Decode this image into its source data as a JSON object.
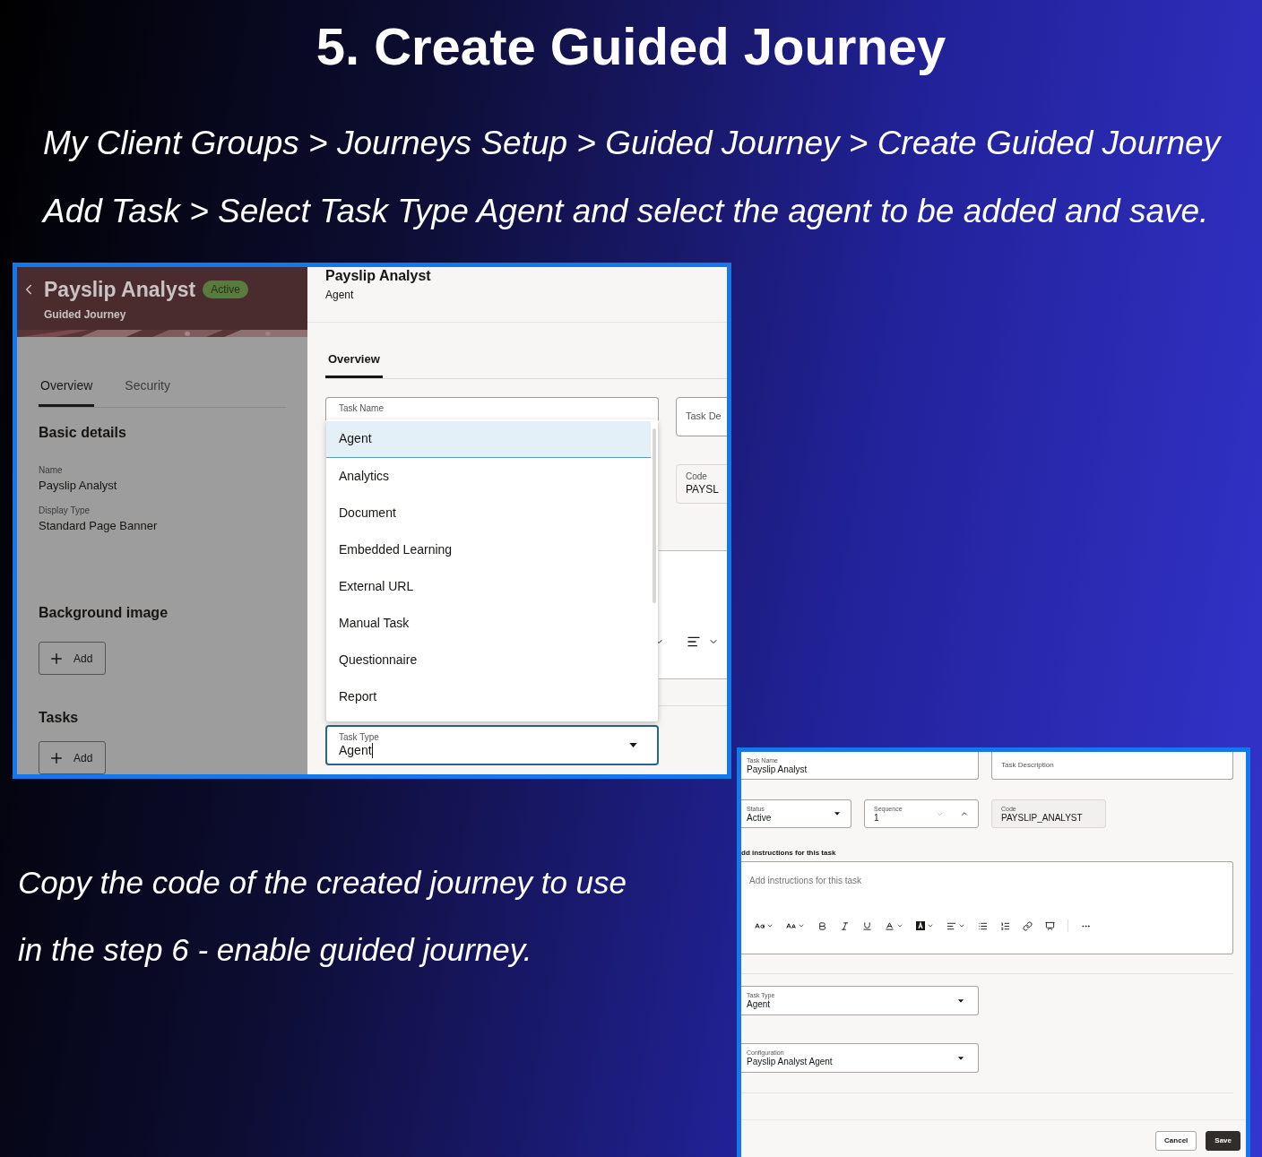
{
  "heading": "5. Create Guided Journey",
  "instructions": [
    "My Client Groups > Journeys Setup > Guided Journey > Create Guided Journey",
    "Add Task  > Select Task Type Agent and select the agent to be added and save."
  ],
  "screenshot_1": {
    "banner": {
      "title": "Payslip Analyst",
      "status": "Active",
      "subtitle": "Guided Journey"
    },
    "tabs": [
      {
        "label": "Overview",
        "selected": true
      },
      {
        "label": "Security",
        "selected": false
      }
    ],
    "basic_details": {
      "heading": "Basic details",
      "fields": [
        {
          "label": "Name",
          "value": "Payslip Analyst"
        },
        {
          "label": "Display Type",
          "value": "Standard Page Banner"
        }
      ]
    },
    "background_image": {
      "heading": "Background image",
      "button": "Add"
    },
    "tasks": {
      "heading": "Tasks",
      "button": "Add"
    },
    "task_panel": {
      "title": "Payslip Analyst",
      "subtitle": "Agent",
      "tabs": [
        {
          "label": "Overview",
          "selected": true
        }
      ],
      "task_name": {
        "label": "Task Name"
      },
      "task_description": {
        "label": "Task De"
      },
      "code": {
        "label": "Code",
        "value": "PAYSL"
      },
      "task_type_options": [
        {
          "label": "Agent",
          "selected": true
        },
        {
          "label": "Analytics",
          "selected": false
        },
        {
          "label": "Document",
          "selected": false
        },
        {
          "label": "Embedded Learning",
          "selected": false
        },
        {
          "label": "External URL",
          "selected": false
        },
        {
          "label": "Manual Task",
          "selected": false
        },
        {
          "label": "Questionnaire",
          "selected": false
        },
        {
          "label": "Report",
          "selected": false
        }
      ],
      "task_type": {
        "label": "Task Type",
        "value": "Agent"
      }
    }
  },
  "copy_note": [
    "Copy the code of the created journey to use",
    "in the step 6 - enable guided journey."
  ],
  "screenshot_2": {
    "task_name": {
      "label": "Task Name",
      "value": "Payslip Analyst"
    },
    "task_description": {
      "placeholder": "Task Description"
    },
    "status": {
      "label": "Status",
      "value": "Active"
    },
    "sequence": {
      "label": "Sequence",
      "value": "1"
    },
    "code": {
      "label": "Code",
      "value": "PAYSLIP_ANALYST"
    },
    "instructions": {
      "label": "dd instructions for this task",
      "placeholder": "Add instructions for this task"
    },
    "task_type": {
      "label": "Task Type",
      "value": "Agent"
    },
    "configuration": {
      "label": "Configuration",
      "value": "Payslip Analyst Agent"
    },
    "buttons": [
      {
        "label": "Cancel",
        "kind": "secondary"
      },
      {
        "label": "Save",
        "kind": "primary"
      }
    ]
  }
}
